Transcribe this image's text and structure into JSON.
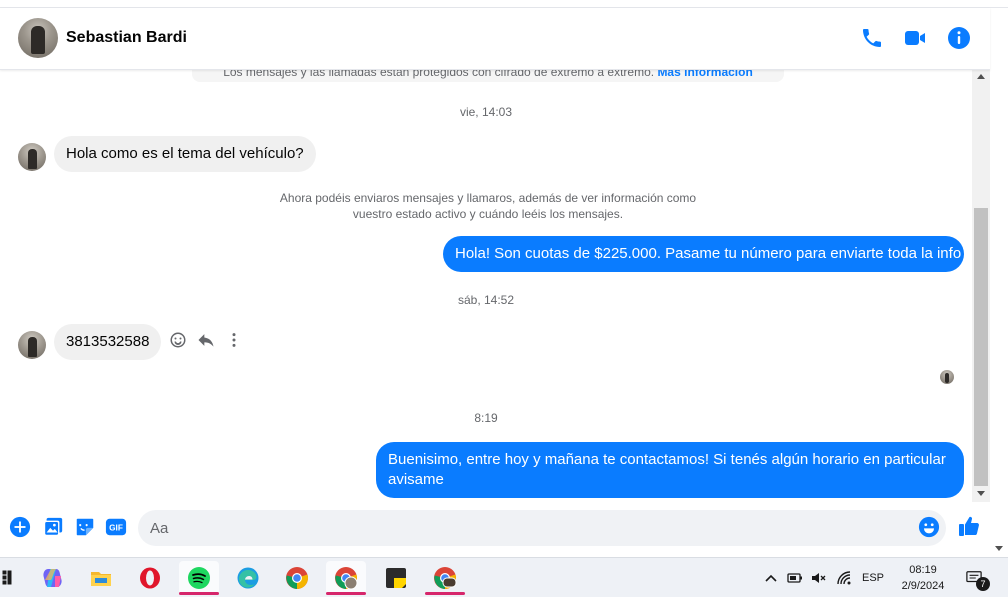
{
  "header": {
    "contact_name": "Sebastian Bardi",
    "actions": [
      "phone-icon",
      "video-icon",
      "info-icon"
    ]
  },
  "chat": {
    "e2e_notice_text": "Los mensajes y las llamadas están protegidos con cifrado de extremo a extremo.",
    "e2e_notice_link": "Más información",
    "timestamps": [
      "vie, 14:03",
      "sáb, 14:52",
      "8:19"
    ],
    "system_message": "Ahora podéis enviaros mensajes y llamaros, además de ver información como vuestro estado activo y cuándo leéis los mensajes.",
    "messages": [
      {
        "direction": "incoming",
        "text": "Hola como es el tema del vehículo?"
      },
      {
        "direction": "outgoing",
        "text": "Hola! Son cuotas de $225.000. Pasame tu número para enviarte toda la info"
      },
      {
        "direction": "incoming",
        "text": "3813532588"
      },
      {
        "direction": "outgoing",
        "text": "Buenisimo, entre hoy y mañana te contactamos! Si tenés algún horario en particular avisame"
      }
    ],
    "message_actions": [
      "emoji-reaction-icon",
      "reply-icon",
      "more-options-icon"
    ]
  },
  "composer": {
    "placeholder": "Aa",
    "tools": [
      "plus-icon",
      "image-icon",
      "sticker-icon",
      "gif-icon"
    ],
    "gif_label": "GIF"
  },
  "taskbar": {
    "apps": [
      "copilot",
      "file-explorer",
      "opera",
      "spotify",
      "edge",
      "chrome",
      "chrome-profile",
      "sticky-notes",
      "chrome-profile-2"
    ],
    "language": "ESP",
    "time": "08:19",
    "date": "2/9/2024",
    "notification_count": "7"
  }
}
